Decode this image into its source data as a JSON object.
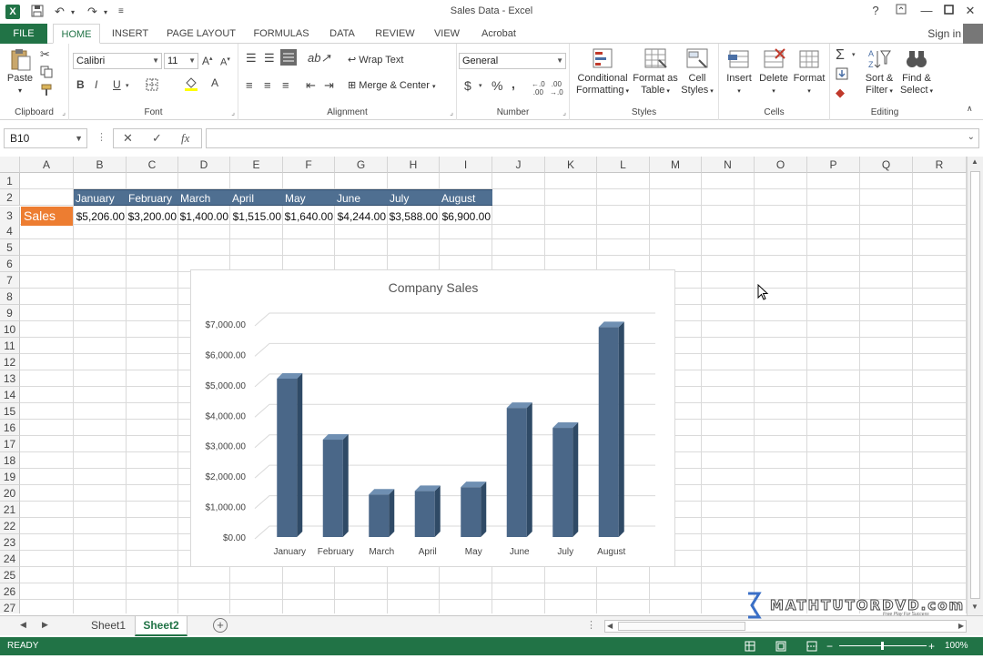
{
  "app": {
    "title": "Sales Data - Excel",
    "logo": "X",
    "colors": {
      "accent": "#217346",
      "month_fill": "#4f6f91",
      "sales_fill": "#ed7d31",
      "bar": "#4a6788"
    }
  },
  "qat": {
    "icons": [
      "save-icon",
      "undo-icon",
      "redo-icon",
      "customize-icon"
    ]
  },
  "window_controls": [
    "help-icon",
    "ribbon-display-icon",
    "minimize-icon",
    "restore-icon",
    "close-icon"
  ],
  "tabs": [
    "FILE",
    "HOME",
    "INSERT",
    "PAGE LAYOUT",
    "FORMULAS",
    "DATA",
    "REVIEW",
    "VIEW",
    "Acrobat"
  ],
  "active_tab": "HOME",
  "signin": "Sign in",
  "ribbon": {
    "clipboard": {
      "label": "Clipboard",
      "paste": "Paste"
    },
    "font": {
      "label": "Font",
      "family": "Calibri",
      "size": "11",
      "bold": "B",
      "italic": "I",
      "underline": "U"
    },
    "alignment": {
      "label": "Alignment",
      "wrap": "Wrap Text",
      "merge": "Merge & Center"
    },
    "number": {
      "label": "Number",
      "format": "General",
      "currency": "$",
      "percent": "%",
      "comma": ","
    },
    "styles": {
      "label": "Styles",
      "conditional_1": "Conditional",
      "conditional_2": "Formatting",
      "format_table_1": "Format as",
      "format_table_2": "Table",
      "cell_styles_1": "Cell",
      "cell_styles_2": "Styles"
    },
    "cells": {
      "label": "Cells",
      "insert": "Insert",
      "delete": "Delete",
      "format": "Format"
    },
    "editing": {
      "label": "Editing",
      "sort_1": "Sort &",
      "sort_2": "Filter",
      "find_1": "Find &",
      "find_2": "Select"
    }
  },
  "formula_bar": {
    "name_box": "B10",
    "cancel": "✕",
    "enter": "✓",
    "fx": "fx",
    "value": ""
  },
  "columns": [
    "A",
    "B",
    "C",
    "D",
    "E",
    "F",
    "G",
    "H",
    "I",
    "J",
    "K",
    "L",
    "M",
    "N",
    "O",
    "P",
    "Q",
    "R"
  ],
  "rows": [
    "1",
    "2",
    "3",
    "4",
    "5",
    "6",
    "7",
    "8",
    "9",
    "10",
    "11",
    "12",
    "13",
    "14",
    "15",
    "16",
    "17",
    "18",
    "19",
    "20",
    "21",
    "22",
    "23",
    "24",
    "25",
    "26",
    "27"
  ],
  "sheet": {
    "row2": [
      "January",
      "February",
      "March",
      "April",
      "May",
      "June",
      "July",
      "August"
    ],
    "row3_label": "Sales",
    "row3": [
      "$5,206.00",
      "$3,200.00",
      "$1,400.00",
      "$1,515.00",
      "$1,640.00",
      "$4,244.00",
      "$3,588.00",
      "$6,900.00"
    ]
  },
  "chart_data": {
    "type": "bar",
    "title": "Company Sales",
    "categories": [
      "January",
      "February",
      "March",
      "April",
      "May",
      "June",
      "July",
      "August"
    ],
    "values": [
      5206,
      3200,
      1400,
      1515,
      1640,
      4244,
      3588,
      6900
    ],
    "ylim": [
      0,
      7000
    ],
    "yticks": [
      "$0.00",
      "$1,000.00",
      "$2,000.00",
      "$3,000.00",
      "$4,000.00",
      "$5,000.00",
      "$6,000.00",
      "$7,000.00"
    ],
    "grid": true,
    "legend": "none",
    "style": "3d-column"
  },
  "sheet_tabs": [
    "Sheet1",
    "Sheet2"
  ],
  "active_sheet": "Sheet2",
  "status": {
    "text": "READY",
    "zoom": "100%"
  },
  "watermark": {
    "text": "MATHTUTORDVD.com",
    "tagline": "Free Play For Success"
  }
}
